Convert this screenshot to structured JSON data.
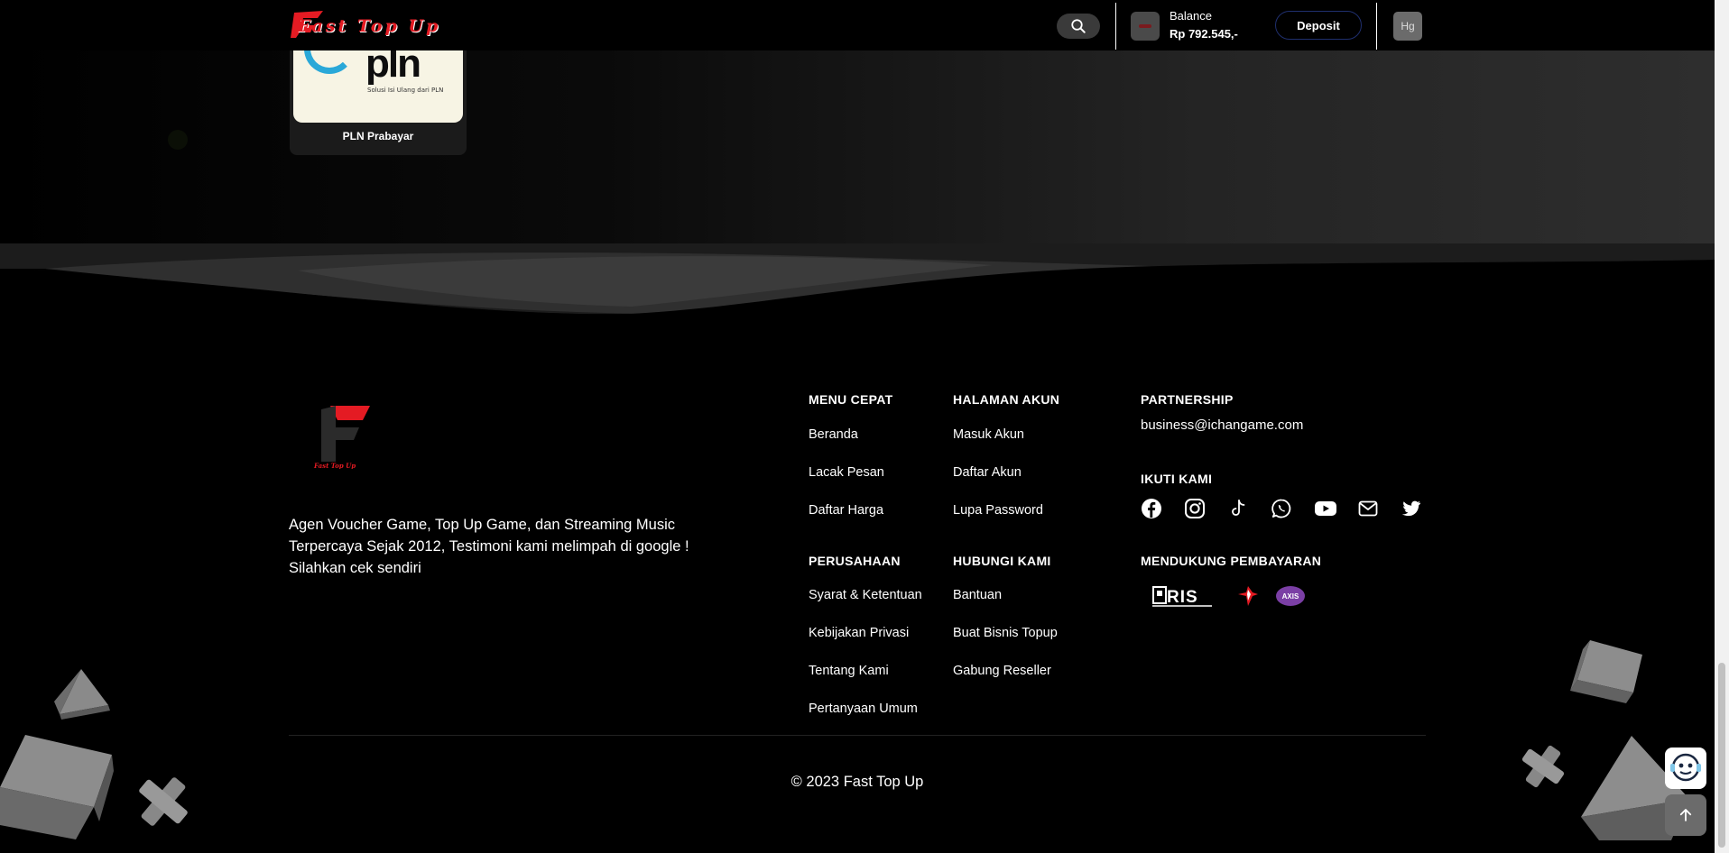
{
  "header": {
    "logo_text": "Fast Top Up",
    "balance_label": "Balance",
    "balance_value": "Rp 792.545,-",
    "deposit_label": "Deposit",
    "user_initials": "Hg",
    "search_icon": "search-icon"
  },
  "product": {
    "name": "PLN Prabayar",
    "image_text": "pln",
    "image_tagline": "Solusi Isi Ulang dari PLN"
  },
  "footer": {
    "logo_text": "Fast Top Up",
    "description": "Agen Voucher Game, Top Up Game, dan Streaming Music Terpercaya Sejak 2012, Testimoni kami melimpah di google ! Silahkan cek sendiri",
    "menu_cepat": {
      "title": "MENU CEPAT",
      "links": [
        "Beranda",
        "Lacak Pesan",
        "Daftar Harga"
      ]
    },
    "halaman_akun": {
      "title": "HALAMAN AKUN",
      "links": [
        "Masuk Akun",
        "Daftar Akun",
        "Lupa Password"
      ]
    },
    "perusahaan": {
      "title": "PERUSAHAAN",
      "links": [
        "Syarat & Ketentuan",
        "Kebijakan Privasi",
        "Tentang Kami",
        "Pertanyaan Umum"
      ]
    },
    "hubungi_kami": {
      "title": "HUBUNGI KAMI",
      "links": [
        "Bantuan",
        "Buat Bisnis Topup",
        "Gabung Reseller"
      ]
    },
    "partnership": {
      "title": "PARTNERSHIP",
      "email": "business@ichangame.com"
    },
    "ikuti_kami": {
      "title": "IKUTI KAMI",
      "icons": [
        "facebook-icon",
        "instagram-icon",
        "tiktok-icon",
        "whatsapp-icon",
        "youtube-icon",
        "mail-icon",
        "twitter-icon"
      ]
    },
    "pembayaran": {
      "title": "MENDUKUNG PEMBAYARAN",
      "methods": [
        "QRIS",
        "Telkomsel",
        "AXIS"
      ]
    },
    "copyright": "© 2023 Fast Top Up"
  },
  "colors": {
    "brand_red": "#e41b23",
    "background": "#000000",
    "deposit_border": "#1f2f6e"
  }
}
